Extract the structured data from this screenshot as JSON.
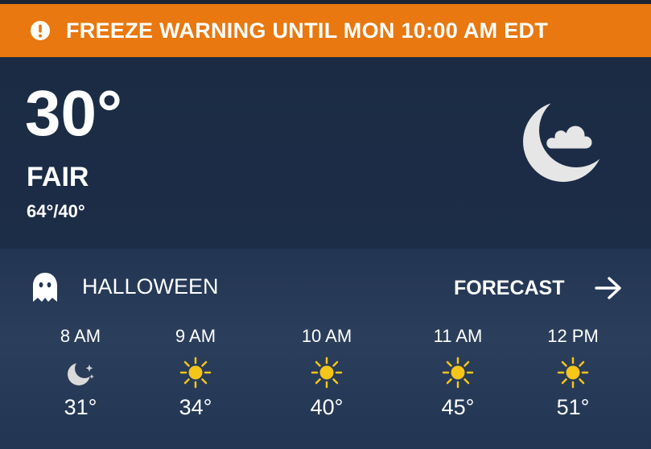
{
  "alert": {
    "text": "FREEZE WARNING UNTIL MON 10:00 AM EDT",
    "icon": "alert-circle-icon",
    "color": "#e8780f"
  },
  "current": {
    "temperature": "30°",
    "condition": "FAIR",
    "hi_lo": "64°/40°",
    "icon": "moon-cloud-icon"
  },
  "holiday": {
    "label": "HALLOWEEN",
    "icon": "ghost-icon"
  },
  "forecast": {
    "label": "FORECAST",
    "icon": "arrow-right-icon"
  },
  "hourly": [
    {
      "time": "8 AM",
      "icon": "moon-stars-icon",
      "temp": "31°"
    },
    {
      "time": "9 AM",
      "icon": "sun-icon",
      "temp": "34°"
    },
    {
      "time": "10 AM",
      "icon": "sun-icon",
      "temp": "40°"
    },
    {
      "time": "11 AM",
      "icon": "sun-icon",
      "temp": "45°"
    },
    {
      "time": "12 PM",
      "icon": "sun-icon",
      "temp": "51°"
    }
  ]
}
